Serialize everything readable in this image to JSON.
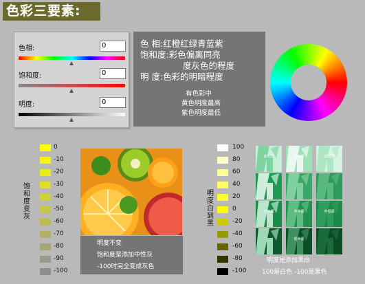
{
  "title": "色彩三要素:",
  "adjust_panel": {
    "hue_label": "色相:",
    "hue_value": "0",
    "saturation_label": "饱和度:",
    "saturation_value": "0",
    "brightness_label": "明度:",
    "brightness_value": "0"
  },
  "description": {
    "line1": "色  相:红橙红绿青蓝紫",
    "line2": "饱和度:彩色偏离同亮",
    "line3": "度灰色的程度",
    "line4": "明  度:色彩的明暗程度",
    "note1": "有色彩中",
    "note2": "黄色明度最高",
    "note3": "紫色明度最低"
  },
  "saturation_scale": {
    "axis_label": "饱和度变灰",
    "steps": [
      {
        "value": "0",
        "color": "#ffff00"
      },
      {
        "value": "-10",
        "color": "#f5f50a"
      },
      {
        "value": "-20",
        "color": "#ebeb1b"
      },
      {
        "value": "-30",
        "color": "#dede29"
      },
      {
        "value": "-40",
        "color": "#d2d238"
      },
      {
        "value": "-50",
        "color": "#c6c646"
      },
      {
        "value": "-60",
        "color": "#bbbb56"
      },
      {
        "value": "-70",
        "color": "#b0b066"
      },
      {
        "value": "-80",
        "color": "#a5a575"
      },
      {
        "value": "-90",
        "color": "#999987"
      },
      {
        "value": "-100",
        "color": "#8e8e8e"
      }
    ]
  },
  "photo": {
    "caption1": "明度不变",
    "caption2": "饱和度是添加中性灰",
    "caption3": "-100时完全变成灰色"
  },
  "brightness_scale": {
    "axis_label": "明度白到黑",
    "steps": [
      {
        "value": "100",
        "color": "#ffffff"
      },
      {
        "value": "80",
        "color": "#ffffcc"
      },
      {
        "value": "60",
        "color": "#ffff99"
      },
      {
        "value": "40",
        "color": "#ffff66"
      },
      {
        "value": "20",
        "color": "#ffff33"
      },
      {
        "value": "0",
        "color": "#ffff00"
      },
      {
        "value": "-20",
        "color": "#cccc00"
      },
      {
        "value": "-40",
        "color": "#999900"
      },
      {
        "value": "-60",
        "color": "#666600"
      },
      {
        "value": "-80",
        "color": "#333300"
      },
      {
        "value": "-100",
        "color": "#000000"
      }
    ]
  },
  "tone_grid": {
    "cells": [
      {
        "label": "高长调",
        "bg": "#c8eed7",
        "fg": "#7fd4a2"
      },
      {
        "label": "高中调",
        "bg": "#9fe0b8",
        "fg": "#e8f8ee"
      },
      {
        "label": "高短调",
        "bg": "#d6f3e1",
        "fg": "#aee5c4"
      },
      {
        "label": "",
        "bg": "#1f9a55",
        "fg": "#cdeedb"
      },
      {
        "label": "",
        "bg": "#3aa868",
        "fg": "#7fcf9f"
      },
      {
        "label": "",
        "bg": "#2e9b5c",
        "fg": "#59b880"
      },
      {
        "label": "中长调",
        "bg": "#1a8c4a",
        "fg": "#b9e6cb"
      },
      {
        "label": "中中调",
        "bg": "#22934f",
        "fg": "#5cbc83"
      },
      {
        "label": "中短调",
        "bg": "#1e8a4a",
        "fg": "#2f9d5d"
      },
      {
        "label": "",
        "bg": "#0d5a2c",
        "fg": "#9ed9b6"
      },
      {
        "label": "低中调",
        "bg": "#0b4f26",
        "fg": "#3f8f5f"
      },
      {
        "label": "",
        "bg": "#0c4c25",
        "fg": "#1a6a3a"
      }
    ],
    "caption1": "明度是添加黑白",
    "caption2": "100是白色  -100是黑色"
  }
}
